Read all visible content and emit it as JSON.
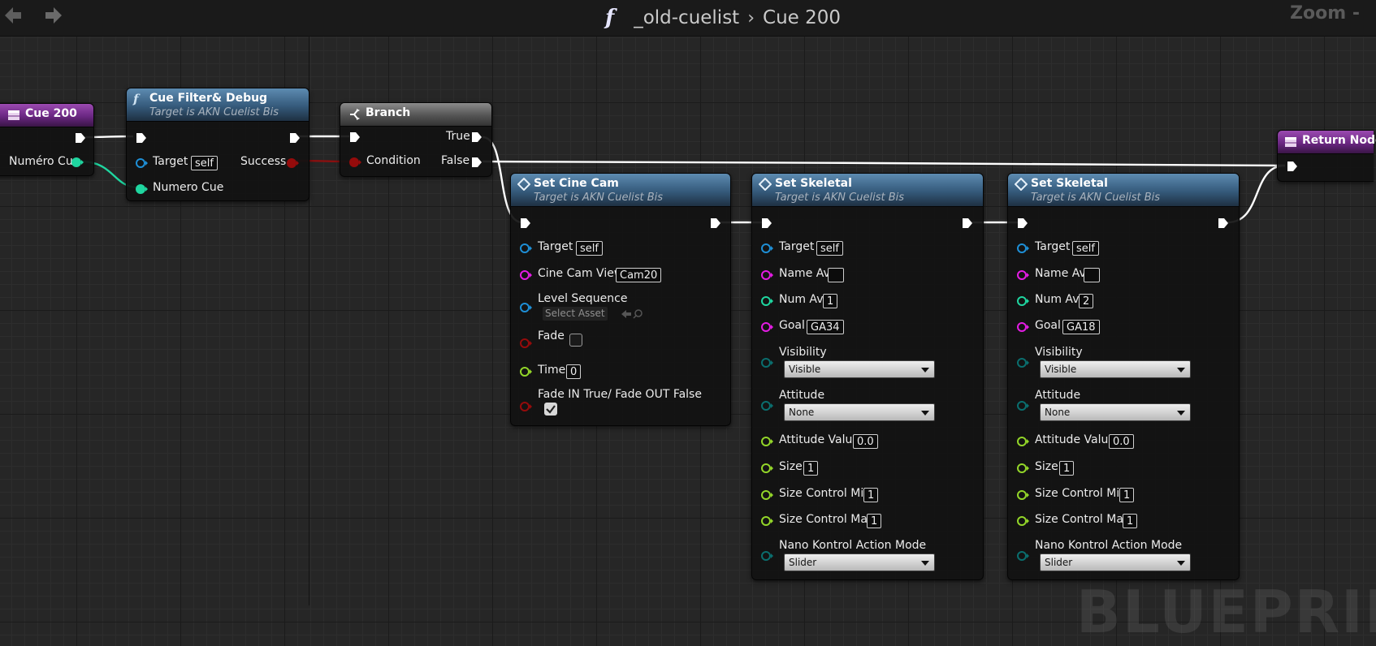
{
  "window": {
    "breadcrumb_graph": "_old-cuelist",
    "breadcrumb_sep": "›",
    "breadcrumb_func": "Cue 200",
    "zoom_label": "Zoom -",
    "watermark": "BLUEPRINT"
  },
  "icons": {
    "back": "arrow-left-icon",
    "forward": "arrow-right-icon",
    "function": "function-icon",
    "entry": "function-entry-icon",
    "branch": "branch-icon",
    "set": "set-variable-icon",
    "return": "return-node-icon"
  },
  "colors": {
    "exec": "#ffffff",
    "object": "#1e8fd6",
    "integer": "#1fd6a0",
    "bool": "#950b0b",
    "float": "#93d629",
    "string": "#e41ce4",
    "byte": "#0a6e6e",
    "header_function": "#355a7b",
    "header_entry": "#6a2782"
  },
  "nodes": {
    "cue_entry": {
      "title": "Cue 200",
      "out_label": "Numéro Cue"
    },
    "filter": {
      "title": "Cue Filter& Debug",
      "subtitle": "Target is AKN Cuelist Bis",
      "target_label": "Target",
      "target_value": "self",
      "success_label": "Success",
      "numero_label": "Numero Cue"
    },
    "branch": {
      "title": "Branch",
      "condition_label": "Condition",
      "true_label": "True",
      "false_label": "False"
    },
    "cine": {
      "title": "Set Cine Cam",
      "subtitle": "Target is AKN Cuelist Bis",
      "target_label": "Target",
      "target_value": "self",
      "view_label": "Cine Cam View",
      "view_value": "Cam20",
      "seq_label": "Level Sequence",
      "seq_value": "Select Asset",
      "fade_label": "Fade",
      "fade_checked": false,
      "time_label": "Time",
      "time_value": "0",
      "fadein_label": "Fade IN True/ Fade OUT False",
      "fadein_checked": true
    },
    "skel1": {
      "title": "Set Skeletal",
      "subtitle": "Target is AKN Cuelist Bis",
      "target_label": "Target",
      "target_value": "self",
      "name_label": "Name Av",
      "name_value": "",
      "num_label": "Num Av",
      "num_value": "1",
      "goal_label": "Goal",
      "goal_value": "GA34",
      "visibility_label": "Visibility",
      "visibility_value": "Visible",
      "attitude_label": "Attitude",
      "attitude_value": "None",
      "attval_label": "Attitude Value",
      "attval_value": "0.0",
      "size_label": "Size",
      "size_value": "1",
      "sizemin_label": "Size Control Min",
      "sizemin_value": "1",
      "sizemax_label": "Size Control Max",
      "sizemax_value": "1",
      "nano_label": "Nano Kontrol Action Mode",
      "nano_value": "Slider"
    },
    "skel2": {
      "title": "Set Skeletal",
      "subtitle": "Target is AKN Cuelist Bis",
      "target_label": "Target",
      "target_value": "self",
      "name_label": "Name Av",
      "name_value": "",
      "num_label": "Num Av",
      "num_value": "2",
      "goal_label": "Goal",
      "goal_value": "GA18",
      "visibility_label": "Visibility",
      "visibility_value": "Visible",
      "attitude_label": "Attitude",
      "attitude_value": "None",
      "attval_label": "Attitude Value",
      "attval_value": "0.0",
      "size_label": "Size",
      "size_value": "1",
      "sizemin_label": "Size Control Min",
      "sizemin_value": "1",
      "sizemax_label": "Size Control Max",
      "sizemax_value": "1",
      "nano_label": "Nano Kontrol Action Mode",
      "nano_value": "Slider"
    },
    "ret": {
      "title": "Return Node"
    }
  }
}
